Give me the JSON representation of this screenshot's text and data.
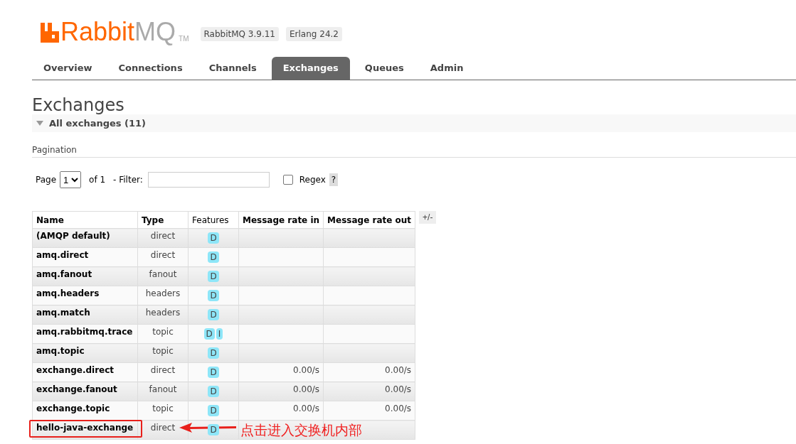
{
  "logo": {
    "brand": "Rabbit",
    "suffix": "MQ",
    "mark": "TM"
  },
  "versions": [
    "RabbitMQ 3.9.11",
    "Erlang 24.2"
  ],
  "tabs": [
    {
      "label": "Overview",
      "selected": false
    },
    {
      "label": "Connections",
      "selected": false
    },
    {
      "label": "Channels",
      "selected": false
    },
    {
      "label": "Exchanges",
      "selected": true
    },
    {
      "label": "Queues",
      "selected": false
    },
    {
      "label": "Admin",
      "selected": false
    }
  ],
  "page_title": "Exchanges",
  "section": {
    "title": "All exchanges (11)",
    "expanded": true
  },
  "pagination": {
    "heading": "Pagination",
    "page_label": "Page",
    "page_value": "1",
    "of_label": "of 1",
    "filter_label": "- Filter:",
    "regex_label": "Regex",
    "regex_checked": false,
    "help": "?"
  },
  "table": {
    "columns": [
      "Name",
      "Type",
      "Features",
      "Message rate in",
      "Message rate out"
    ],
    "toggle": "+/-",
    "rows": [
      {
        "name": "(AMQP default)",
        "type": "direct",
        "features": [
          "D"
        ],
        "rate_in": "",
        "rate_out": ""
      },
      {
        "name": "amq.direct",
        "type": "direct",
        "features": [
          "D"
        ],
        "rate_in": "",
        "rate_out": ""
      },
      {
        "name": "amq.fanout",
        "type": "fanout",
        "features": [
          "D"
        ],
        "rate_in": "",
        "rate_out": ""
      },
      {
        "name": "amq.headers",
        "type": "headers",
        "features": [
          "D"
        ],
        "rate_in": "",
        "rate_out": ""
      },
      {
        "name": "amq.match",
        "type": "headers",
        "features": [
          "D"
        ],
        "rate_in": "",
        "rate_out": ""
      },
      {
        "name": "amq.rabbitmq.trace",
        "type": "topic",
        "features": [
          "D",
          "I"
        ],
        "rate_in": "",
        "rate_out": ""
      },
      {
        "name": "amq.topic",
        "type": "topic",
        "features": [
          "D"
        ],
        "rate_in": "",
        "rate_out": ""
      },
      {
        "name": "exchange.direct",
        "type": "direct",
        "features": [
          "D"
        ],
        "rate_in": "0.00/s",
        "rate_out": "0.00/s"
      },
      {
        "name": "exchange.fanout",
        "type": "fanout",
        "features": [
          "D"
        ],
        "rate_in": "0.00/s",
        "rate_out": "0.00/s"
      },
      {
        "name": "exchange.topic",
        "type": "topic",
        "features": [
          "D"
        ],
        "rate_in": "0.00/s",
        "rate_out": "0.00/s"
      },
      {
        "name": "hello-java-exchange",
        "type": "direct",
        "features": [
          "D"
        ],
        "rate_in": "",
        "rate_out": ""
      }
    ]
  },
  "annotation": {
    "text": "点击进入交换机内部"
  }
}
